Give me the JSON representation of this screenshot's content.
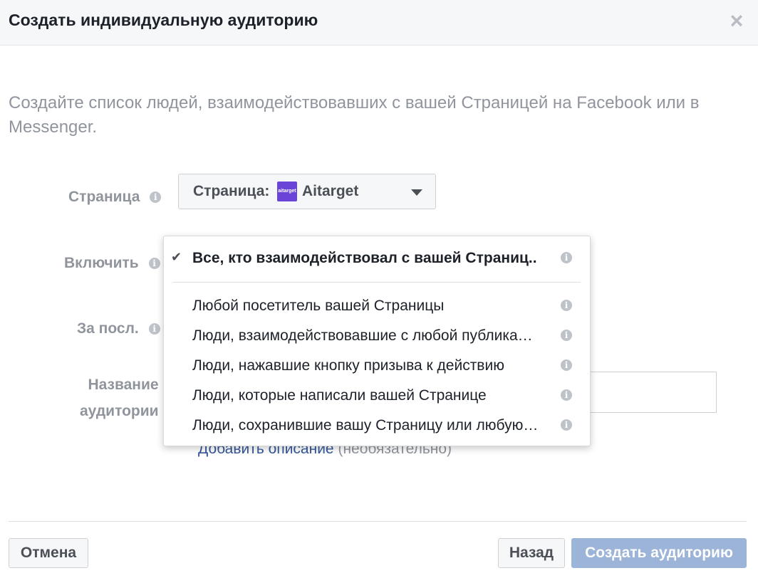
{
  "header": {
    "title": "Создать индивидуальную аудиторию",
    "close_glyph": "×"
  },
  "intro": "Создайте список людей, взаимодействовавших с вашей Страницей на Facebook или в Messenger.",
  "form": {
    "page_label": "Страница",
    "include_label": "Включить",
    "period_label": "За посл.",
    "name_label_line1": "Название",
    "name_label_line2": "аудитории",
    "info_glyph": "i",
    "page_select": {
      "prefix": "Страница:",
      "logo_text": "aitarget",
      "value": "Aitarget"
    },
    "add_description_link": "Добавить описание",
    "add_description_optional": "(необязательно)"
  },
  "dropdown": {
    "selected_check": "✔",
    "selected": "Все, кто взаимодействовал с вашей Страниц..",
    "options": [
      "Любой посетитель вашей Страницы",
      "Люди, взаимодействовавшие с любой публика…",
      "Люди, нажавшие кнопку призыва к действию",
      "Люди, которые написали вашей Странице",
      "Люди, сохранившие вашу Страницу или любую…"
    ]
  },
  "footer": {
    "cancel": "Отмена",
    "back": "Назад",
    "create": "Создать аудиторию"
  },
  "colors": {
    "accent_disabled": "#9cb4d8",
    "link": "#365899",
    "muted": "#90949c"
  }
}
